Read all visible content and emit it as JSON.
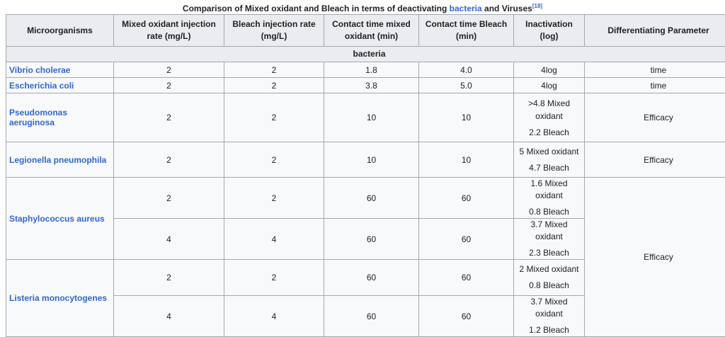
{
  "caption": {
    "prefix": "Comparison of Mixed oxidant and Bleach in terms of deactivating ",
    "link": "bacteria",
    "suffix": " and Viruses",
    "ref": "[18]"
  },
  "headers": [
    "Microorganisms",
    "Mixed oxidant injection rate (mg/L)",
    "Bleach injection rate (mg/L)",
    "Contact time mixed oxidant (min)",
    "Contact time Bleach (min)",
    "Inactivation (log)",
    "Differentiating Parameter"
  ],
  "section": "bacteria",
  "rows": {
    "vibrio": {
      "org": "Vibrio cholerae",
      "mix_rate": "2",
      "bleach_rate": "2",
      "ct_mix": "1.8",
      "ct_bleach": "4.0",
      "inact": "4log",
      "param": "time"
    },
    "ecoli": {
      "org": "Escherichia coli",
      "mix_rate": "2",
      "bleach_rate": "2",
      "ct_mix": "3.8",
      "ct_bleach": "5.0",
      "inact": "4log",
      "param": "time"
    },
    "pseudo": {
      "org": "Pseudomonas aeruginosa",
      "mix_rate": "2",
      "bleach_rate": "2",
      "ct_mix": "10",
      "ct_bleach": "10",
      "inact_a": ">4.8 Mixed",
      "inact_b": "oxidant",
      "inact_c": "2.2 Bleach",
      "param": "Efficacy"
    },
    "legion": {
      "org": "Legionella pneumophila",
      "mix_rate": "2",
      "bleach_rate": "2",
      "ct_mix": "10",
      "ct_bleach": "10",
      "inact_a": "5 Mixed oxidant",
      "inact_b": "4.7 Bleach",
      "param": "Efficacy"
    },
    "staph1": {
      "org": "Staphylococcus aureus",
      "mix_rate": "2",
      "bleach_rate": "2",
      "ct_mix": "60",
      "ct_bleach": "60",
      "inact_a": "1.6 Mixed oxidant",
      "inact_b": "0.8 Bleach",
      "param": "Efficacy"
    },
    "staph2": {
      "mix_rate": "4",
      "bleach_rate": "4",
      "ct_mix": "60",
      "ct_bleach": "60",
      "inact_a": "3.7 Mixed oxidant",
      "inact_b": "2.3 Bleach"
    },
    "list1": {
      "org": "Listeria monocytogenes",
      "mix_rate": "2",
      "bleach_rate": "2",
      "ct_mix": "60",
      "ct_bleach": "60",
      "inact_a": "2 Mixed oxidant",
      "inact_b": "0.8 Bleach"
    },
    "list2": {
      "mix_rate": "4",
      "bleach_rate": "4",
      "ct_mix": "60",
      "ct_bleach": "60",
      "inact_a": "3.7 Mixed oxidant",
      "inact_b": "1.2 Bleach"
    }
  }
}
